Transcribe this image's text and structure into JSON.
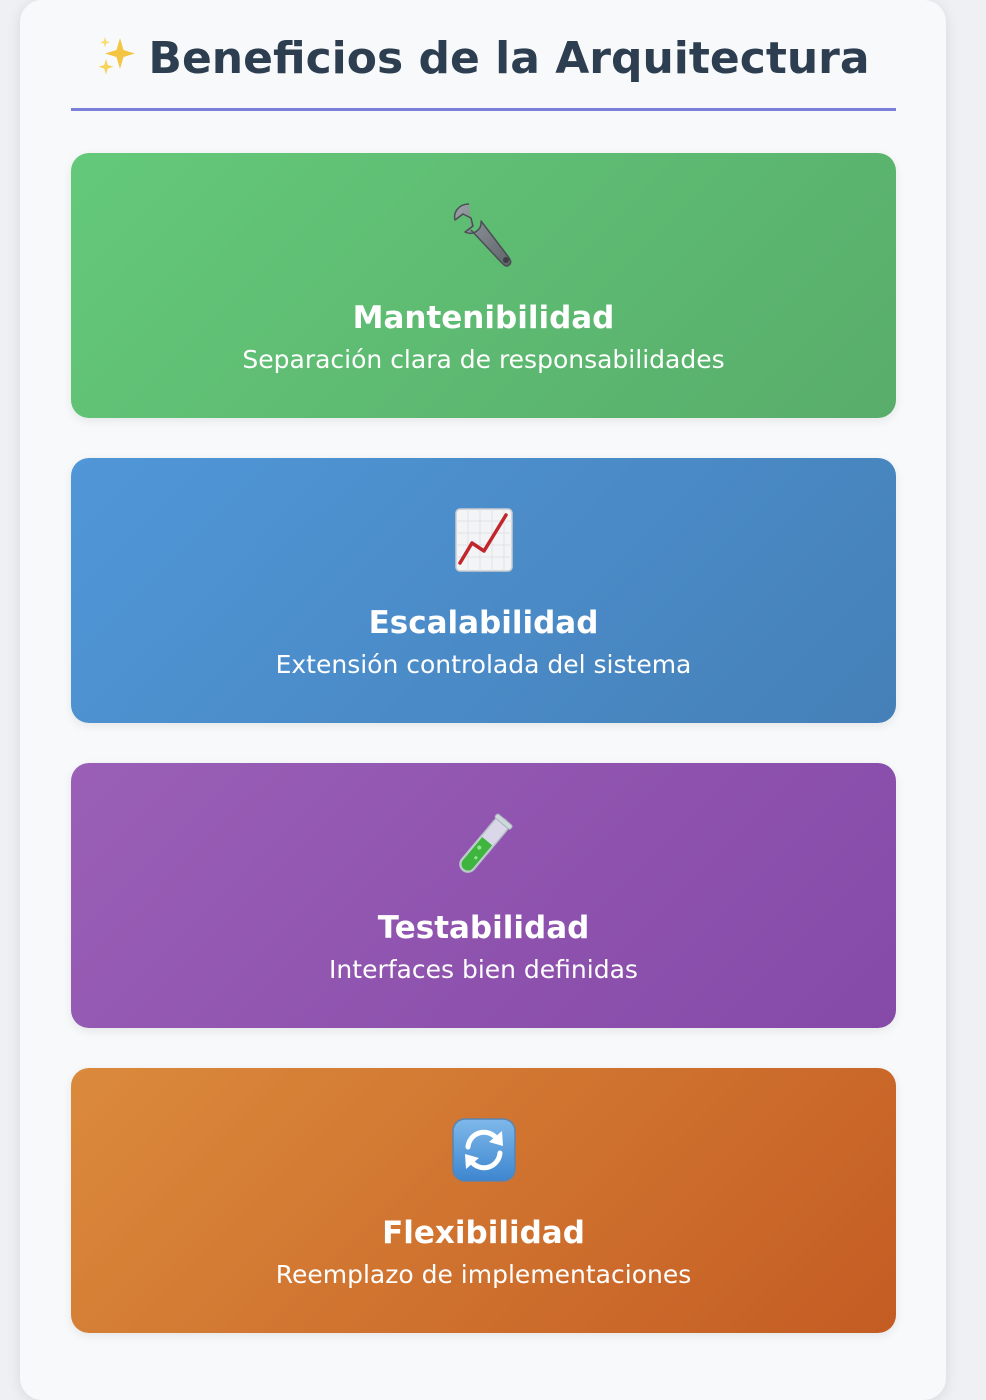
{
  "header": {
    "title": "Beneficios de la Arquitectura",
    "title_icon": "sparkles-icon"
  },
  "cards": [
    {
      "icon": "wrench-icon",
      "title": "Mantenibilidad",
      "description": "Separación clara de responsabilidades",
      "gradient": [
        "#64c97a",
        "#58ad6a"
      ]
    },
    {
      "icon": "chart-increasing-icon",
      "title": "Escalabilidad",
      "description": "Extensión controlada del sistema",
      "gradient": [
        "#5097d8",
        "#4580b8"
      ]
    },
    {
      "icon": "test-tube-icon",
      "title": "Testabilidad",
      "description": "Interfaces bien definidas",
      "gradient": [
        "#9a5fb6",
        "#8549a8"
      ]
    },
    {
      "icon": "arrows-counterclockwise-icon",
      "title": "Flexibilidad",
      "description": "Reemplazo de implementaciones",
      "gradient": [
        "#db8a3c",
        "#c45c23"
      ]
    }
  ],
  "colors": {
    "title_text": "#2c3e50",
    "divider": "#7b7fd9",
    "panel_bg": "#f7f9fb"
  }
}
